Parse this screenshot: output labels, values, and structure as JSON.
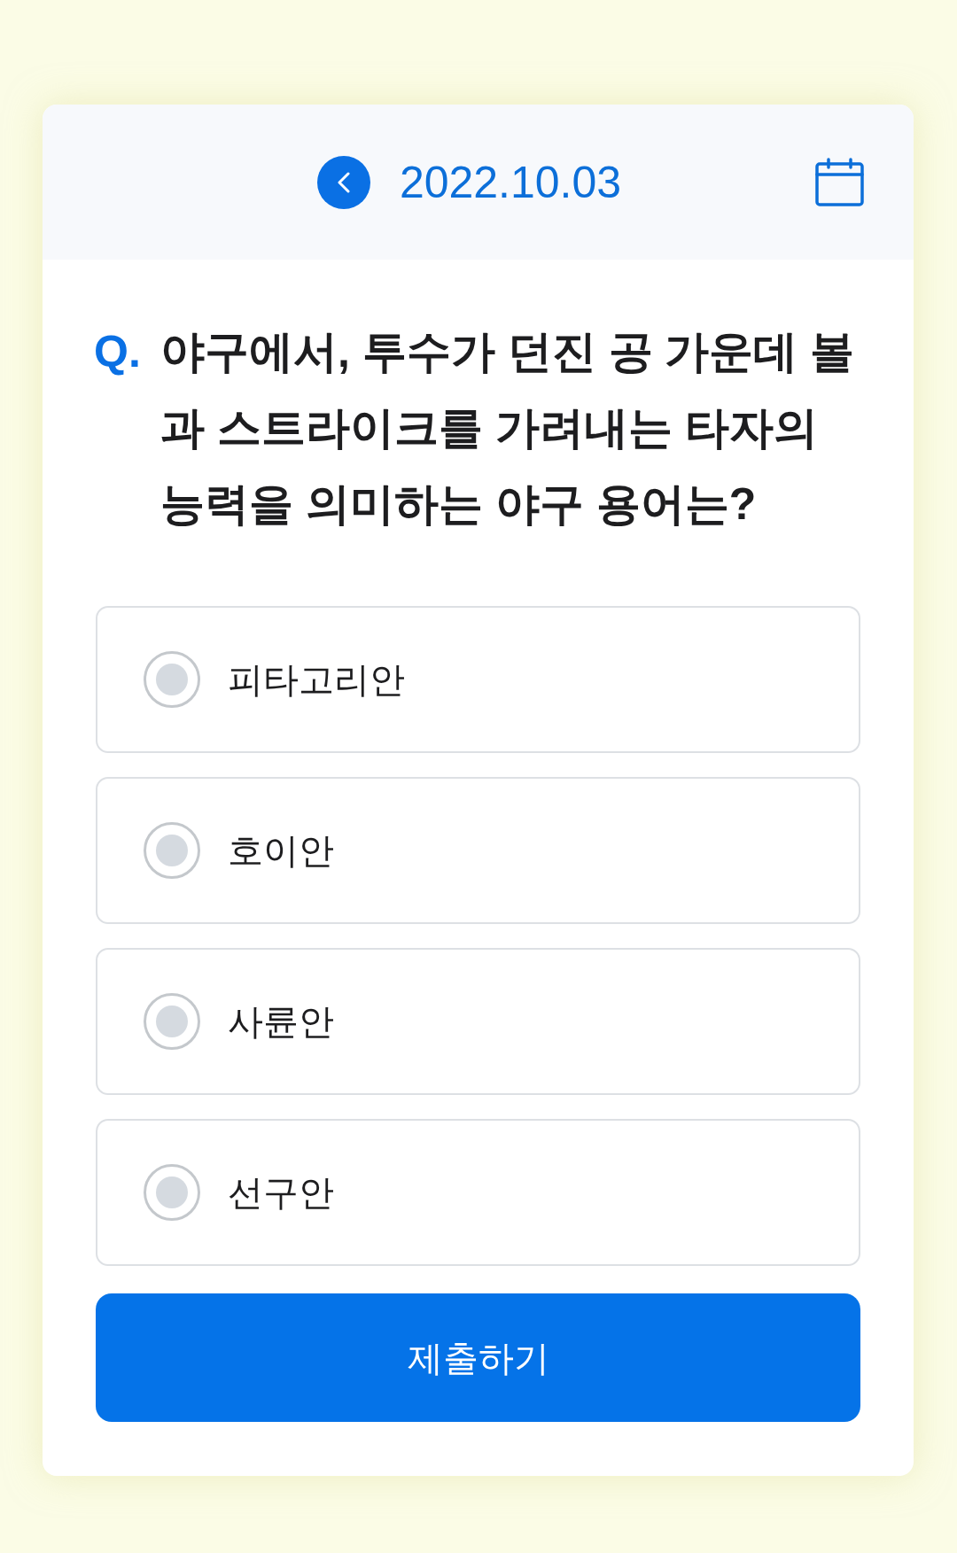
{
  "header": {
    "date": "2022.10.03"
  },
  "question": {
    "marker": "Q.",
    "text": "야구에서, 투수가 던진 공 가운데 볼과 스트라이크를 가려내는 타자의 능력을 의미하는 야구 용어는?"
  },
  "options": [
    {
      "label": "피타고리안",
      "selected": false
    },
    {
      "label": "호이안",
      "selected": false
    },
    {
      "label": "사륜안",
      "selected": false
    },
    {
      "label": "선구안",
      "selected": false
    }
  ],
  "submit_button": "제출하기"
}
